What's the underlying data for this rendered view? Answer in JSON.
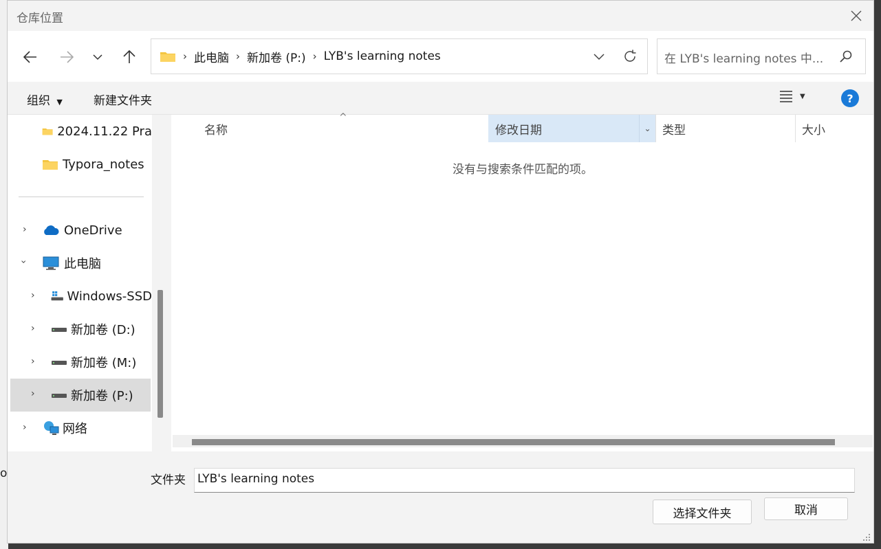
{
  "window": {
    "title": "仓库位置"
  },
  "navigation": {
    "breadcrumbs": [
      "此电脑",
      "新加卷 (P:)",
      "LYB's learning notes"
    ],
    "search_placeholder": "在 LYB's learning notes 中..."
  },
  "toolbar": {
    "organize_label": "组织",
    "new_folder_label": "新建文件夹"
  },
  "sidebar": {
    "items": [
      {
        "label": "2024.11.22 Pra",
        "icon": "folder-icon"
      },
      {
        "label": "Typora_notes",
        "icon": "folder-icon"
      },
      {
        "label": "OneDrive",
        "icon": "cloud-icon",
        "expanded": false
      },
      {
        "label": "此电脑",
        "icon": "computer-icon",
        "expanded": true
      },
      {
        "label": "Windows-SSD",
        "icon": "windows-drive-icon",
        "expanded": false
      },
      {
        "label": "新加卷 (D:)",
        "icon": "drive-icon",
        "expanded": false
      },
      {
        "label": "新加卷 (M:)",
        "icon": "drive-icon",
        "expanded": false
      },
      {
        "label": "新加卷 (P:)",
        "icon": "drive-icon",
        "expanded": false,
        "selected": true
      },
      {
        "label": "网络",
        "icon": "network-icon",
        "expanded": false
      }
    ]
  },
  "file_list": {
    "columns": [
      "名称",
      "修改日期",
      "类型",
      "大小"
    ],
    "empty_message": "没有与搜索条件匹配的项。"
  },
  "footer": {
    "folder_label": "文件夹",
    "folder_value": "LYB's learning notes",
    "select_button": "选择文件夹",
    "cancel_button": "取消"
  },
  "background": {
    "stray_text": "o"
  },
  "colors": {
    "accent": "#1a7ad8",
    "selected_row": "#dcdcdc",
    "column_hover": "#d9e8f7",
    "folder": "#f4c542"
  }
}
